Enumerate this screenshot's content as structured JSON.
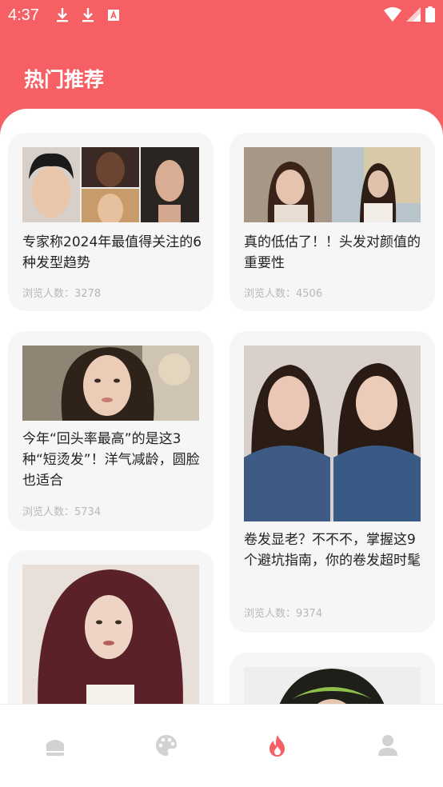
{
  "status_bar": {
    "time": "4:37",
    "left_icons": [
      "download-icon",
      "download-icon",
      "font-icon"
    ],
    "right_icons": [
      "wifi-icon",
      "signal-icon",
      "battery-icon"
    ]
  },
  "header": {
    "title": "热门推荐",
    "bg_color": "#f65f64"
  },
  "cards": [
    {
      "title": "专家称2024年最值得关注的6种发型趋势",
      "views": "浏览人数：3278"
    },
    {
      "title": "真的低估了！！头发对颜值的重要性",
      "views": "浏览人数：4506"
    },
    {
      "title": "今年“回头率最高”的是这3种“短烫发”！洋气减龄，圆脸也适合",
      "views": "浏览人数：5734"
    },
    {
      "title": "卷发显老？不不不，掌握这9个避坑指南，你的卷发超时髦",
      "views": "浏览人数：9374"
    },
    {
      "title": "",
      "views": ""
    },
    {
      "title": "",
      "views": ""
    }
  ],
  "tabbar": {
    "tabs": [
      {
        "icon": "home-icon",
        "active": false
      },
      {
        "icon": "palette-icon",
        "active": false
      },
      {
        "icon": "fire-icon",
        "active": true
      },
      {
        "icon": "user-icon",
        "active": false
      }
    ],
    "active_color": "#f65f64",
    "inactive_color": "#d2d2d2"
  }
}
